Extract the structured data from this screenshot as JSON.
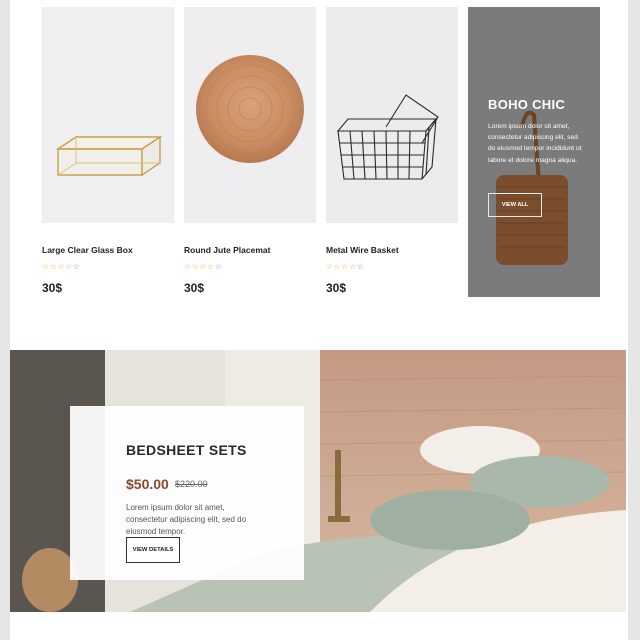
{
  "products": [
    {
      "name": "Large Clear Glass Box",
      "price": "30$",
      "rating": 0,
      "image_icon": "glass-box-image"
    },
    {
      "name": "Round Jute Placemat",
      "price": "30$",
      "rating": 0,
      "image_icon": "jute-placemat-image"
    },
    {
      "name": "Metal Wire Basket",
      "price": "30$",
      "rating": 0,
      "image_icon": "wire-basket-image"
    }
  ],
  "stars": {
    "full": "☆☆☆☆",
    "last": "☆"
  },
  "promo": {
    "title": "BOHO CHIC",
    "text": "Lorem ipsum dolor sit amet, consectetur adipiscing elit, sed do eiusmod tempor incididunt ut labore et dolore magna aliqua.",
    "button": "VIEW ALL"
  },
  "banner": {
    "title": "BEDSHEET SETS",
    "price": "$50.00",
    "old_price": "$220.00",
    "text": "Lorem ipsum dolor sit amet, consectetur adipiscing elit, sed do eiusmod tempor.",
    "button": "VIEW DETAILS"
  },
  "colors": {
    "promo_bg": "#7a7a7a",
    "price_accent": "#8b4a2b",
    "page_bg": "#ffffff"
  }
}
